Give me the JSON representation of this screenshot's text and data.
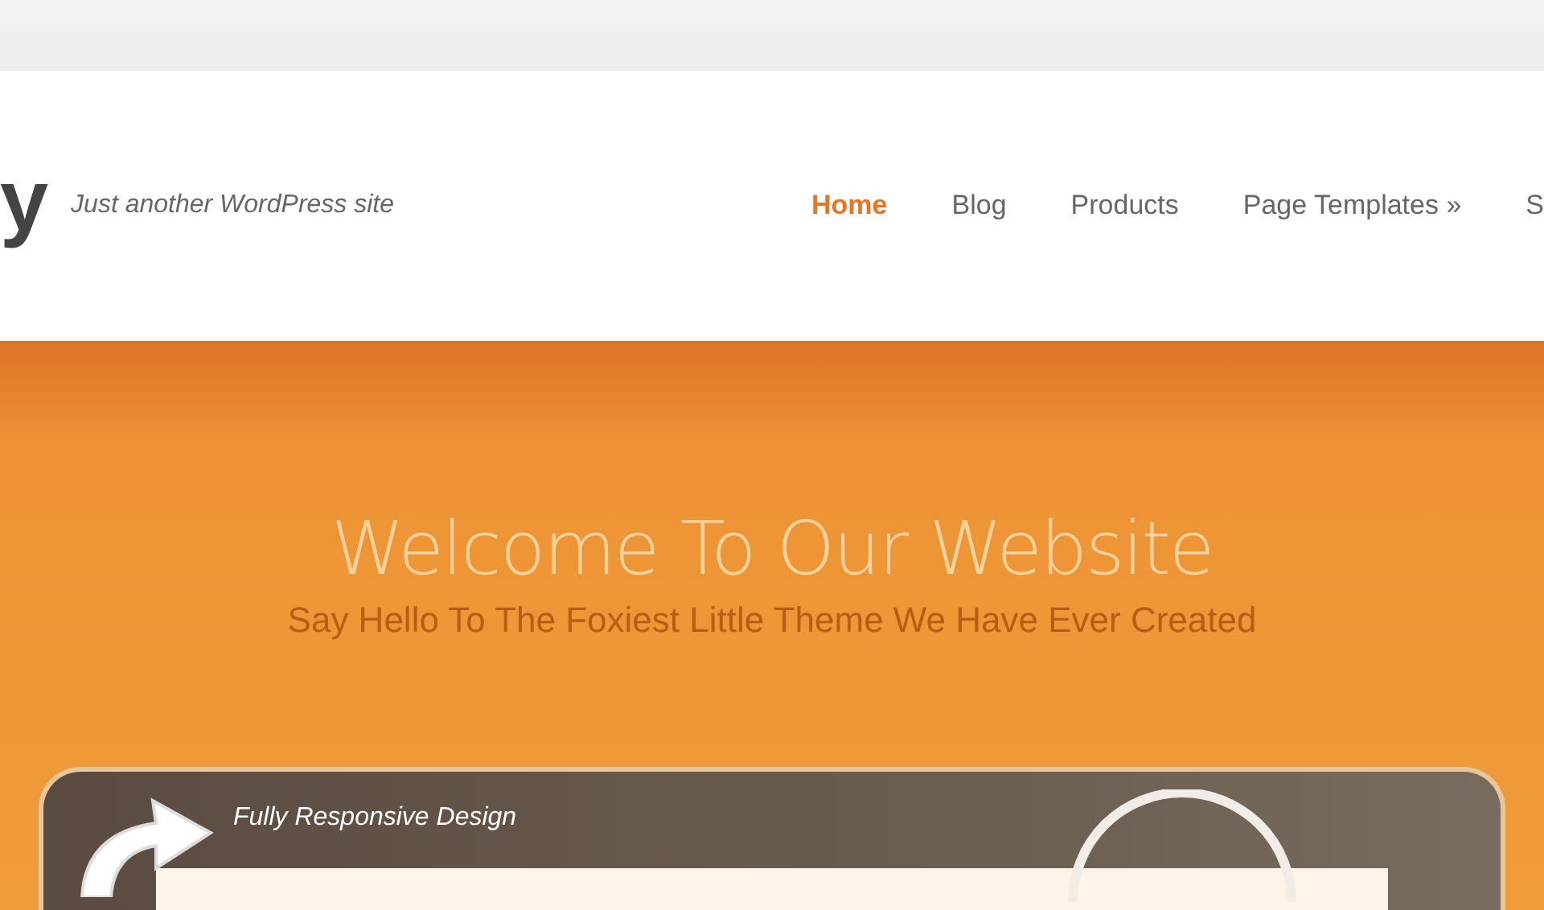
{
  "header": {
    "logo": "y",
    "tagline": "Just another WordPress site"
  },
  "nav": [
    {
      "label": "Home",
      "selected": true
    },
    {
      "label": "Blog",
      "selected": false
    },
    {
      "label": "Products",
      "selected": false
    },
    {
      "label": "Page Templates »",
      "selected": false
    },
    {
      "label": "S",
      "selected": false
    }
  ],
  "hero": {
    "title": "Welcome To Our Website",
    "subtitle": "Say Hello To The Foxiest Little Theme We Have Ever Created",
    "device_caption": "Fully Responsive Design"
  }
}
